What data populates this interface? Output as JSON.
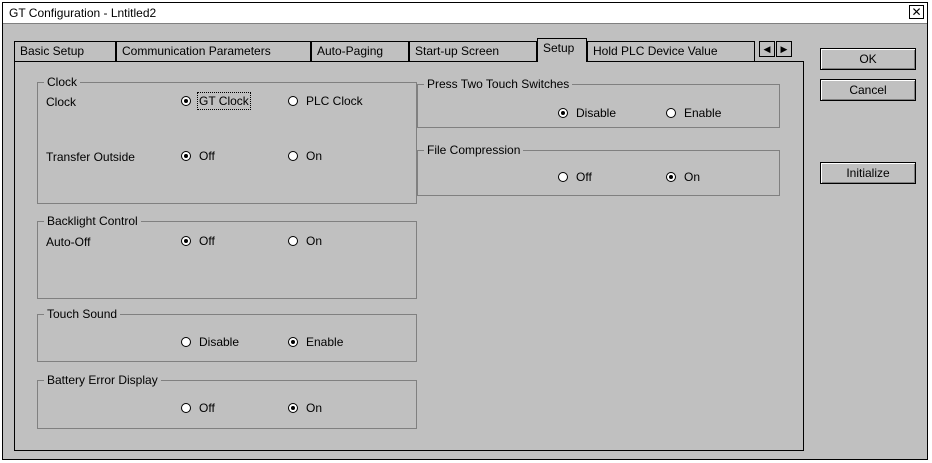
{
  "window": {
    "title": "GT Configuration - Lntitled2"
  },
  "tabs": [
    "Basic Setup",
    "Communication Parameters",
    "Auto-Paging",
    "Start-up Screen",
    "Setup",
    "Hold PLC Device Value"
  ],
  "active_tab": "Setup",
  "buttons": {
    "ok": "OK",
    "cancel": "Cancel",
    "initialize": "Initialize"
  },
  "clock_group": {
    "title": "Clock",
    "clock_label": "Clock",
    "clock_opt1": "GT Clock",
    "clock_opt2": "PLC Clock",
    "transfer_label": "Transfer Outside",
    "transfer_off": "Off",
    "transfer_on": "On"
  },
  "backlight_group": {
    "title": "Backlight Control",
    "auto_off_label": "Auto-Off",
    "off": "Off",
    "on": "On"
  },
  "touch_sound_group": {
    "title": "Touch Sound",
    "disable": "Disable",
    "enable": "Enable"
  },
  "battery_group": {
    "title": "Battery Error Display",
    "off": "Off",
    "on": "On"
  },
  "press_two_group": {
    "title": "Press Two Touch Switches",
    "disable": "Disable",
    "enable": "Enable"
  },
  "file_comp_group": {
    "title": "File Compression",
    "off": "Off",
    "on": "On"
  }
}
